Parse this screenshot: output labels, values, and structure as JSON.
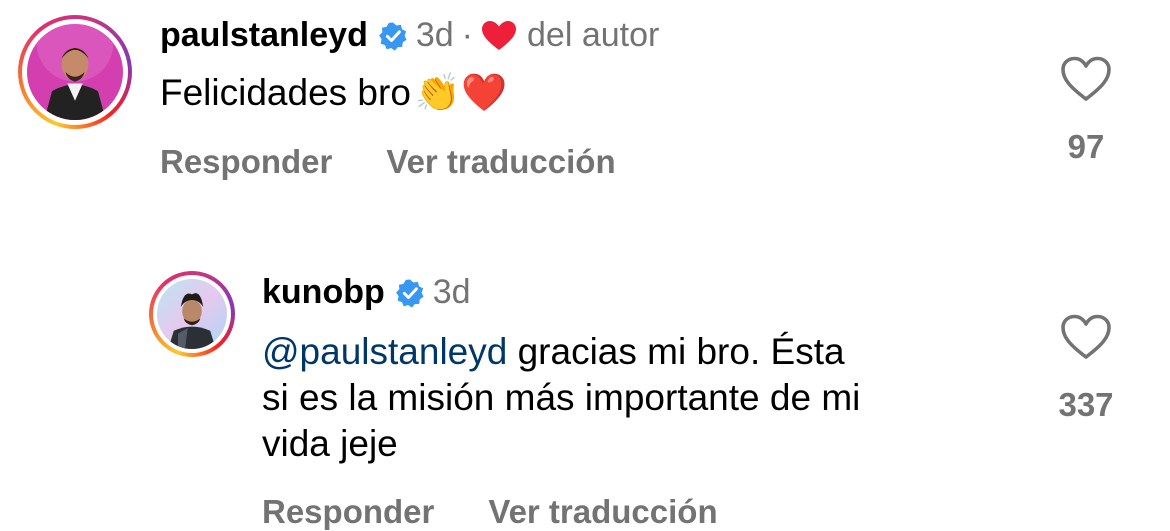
{
  "comments": [
    {
      "username": "paulstanleyd",
      "time": "3d",
      "separator": "·",
      "author_label": "del autor",
      "text": "Felicidades bro",
      "emojis": "👏❤️",
      "reply_label": "Responder",
      "translate_label": "Ver traducción",
      "likes": "97"
    },
    {
      "username": "kunobp",
      "time": "3d",
      "mention": "@paulstanleyd",
      "text": " gracias mi bro. Ésta si es la misión más importante de mi vida jeje",
      "line1_rest": " gracias mi bro. Ésta",
      "line2": "si es la misión más importante de mi",
      "line3": "vida jeje",
      "reply_label": "Responder",
      "translate_label": "Ver traducción",
      "likes": "337"
    }
  ],
  "colors": {
    "secondary_text": "#737373",
    "mention": "#00376b",
    "verified": "#3897f0",
    "heart_red": "#ed1f3a"
  },
  "icons": {
    "verified": "verified-badge-icon",
    "like": "heart-outline-icon",
    "author_like": "heart-filled-icon"
  }
}
